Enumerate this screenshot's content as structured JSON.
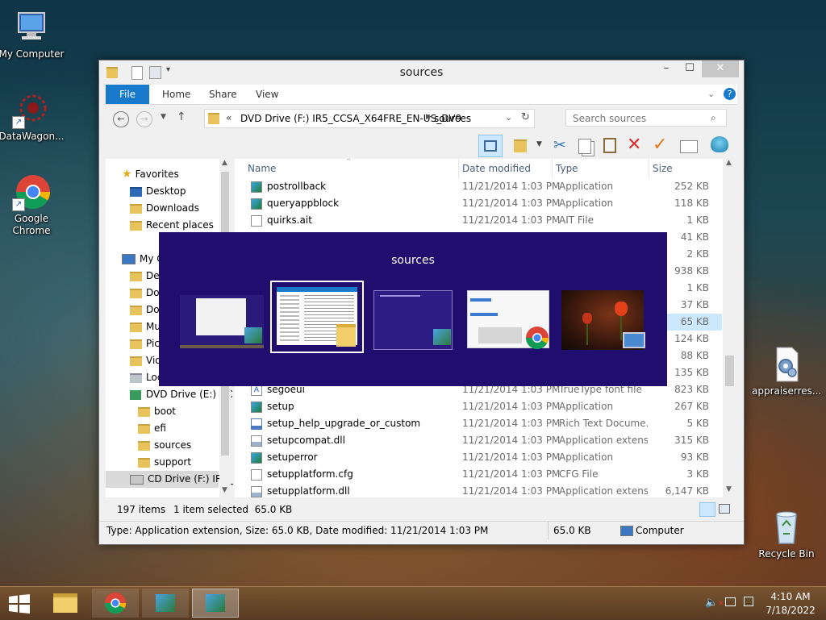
{
  "desktop": {
    "icons": [
      {
        "label": "My Computer",
        "icon": "computer-icon"
      },
      {
        "label": "DataWagon...",
        "icon": "datawagon-icon"
      },
      {
        "label": "Google Chrome",
        "icon": "chrome-icon"
      },
      {
        "label": "appraiserres...",
        "icon": "settings-file-icon"
      },
      {
        "label": "Recycle Bin",
        "icon": "recycle-bin-icon"
      }
    ]
  },
  "window": {
    "title": "sources",
    "ribbon_tabs": [
      "File",
      "Home",
      "Share",
      "View"
    ],
    "address": {
      "prefix": "«",
      "crumbs": [
        "DVD Drive (F:) IR5_CCSA_X64FRE_EN-US_DV9",
        "sources"
      ]
    },
    "search_placeholder": "Search sources",
    "nav": {
      "favorites_label": "Favorites",
      "favorites": [
        "Desktop",
        "Downloads",
        "Recent places"
      ],
      "computer_label": "My C",
      "computer_items": [
        "Des",
        "Do",
        "Do",
        "Mu",
        "Pic",
        "Vid",
        "Loc"
      ],
      "dvd_label": "DVD Drive (E:) CC",
      "dvd_children": [
        "boot",
        "efi",
        "sources",
        "support"
      ],
      "cd_label": "CD Drive (F:) IR5_"
    },
    "columns": {
      "name": "Name",
      "date": "Date modified",
      "type": "Type",
      "size": "Size"
    },
    "files": [
      {
        "name": "postrollback",
        "date": "11/21/2014 1:03 PM",
        "type": "Application",
        "size": "252 KB",
        "icon": "app"
      },
      {
        "name": "queryappblock",
        "date": "11/21/2014 1:03 PM",
        "type": "Application",
        "size": "118 KB",
        "icon": "app"
      },
      {
        "name": "quirks.ait",
        "date": "11/21/2014 1:03 PM",
        "type": "AIT File",
        "size": "1 KB",
        "icon": "file"
      },
      {
        "name": "",
        "date": "",
        "type": "",
        "size": "41 KB",
        "icon": ""
      },
      {
        "name": "",
        "date": "",
        "type": "",
        "size": "2 KB",
        "icon": ""
      },
      {
        "name": "",
        "date": "",
        "type": "",
        "size": "938 KB",
        "icon": ""
      },
      {
        "name": "",
        "date": "",
        "type": "",
        "size": "1 KB",
        "icon": ""
      },
      {
        "name": "",
        "date": "",
        "type": "",
        "size": "37 KB",
        "icon": ""
      },
      {
        "name": "",
        "date": "",
        "type": "",
        "size": "65 KB",
        "icon": "",
        "selected": true
      },
      {
        "name": "",
        "date": "",
        "type": "",
        "size": "124 KB",
        "icon": ""
      },
      {
        "name": "",
        "date": "",
        "type": "",
        "size": "88 KB",
        "icon": ""
      },
      {
        "name": "",
        "date": "",
        "type": "",
        "size": "135 KB",
        "icon": ""
      },
      {
        "name": "segoeui",
        "date": "11/21/2014 1:03 PM",
        "type": "TrueType font file",
        "size": "823 KB",
        "icon": "font"
      },
      {
        "name": "setup",
        "date": "11/21/2014 1:03 PM",
        "type": "Application",
        "size": "267 KB",
        "icon": "app"
      },
      {
        "name": "setup_help_upgrade_or_custom",
        "date": "11/21/2014 1:03 PM",
        "type": "Rich Text Docume...",
        "size": "5 KB",
        "icon": "rtf"
      },
      {
        "name": "setupcompat.dll",
        "date": "11/21/2014 1:03 PM",
        "type": "Application extens...",
        "size": "315 KB",
        "icon": "dll"
      },
      {
        "name": "setuperror",
        "date": "11/21/2014 1:03 PM",
        "type": "Application",
        "size": "93 KB",
        "icon": "app"
      },
      {
        "name": "setupplatform.cfg",
        "date": "11/21/2014 1:03 PM",
        "type": "CFG File",
        "size": "3 KB",
        "icon": "file"
      },
      {
        "name": "setupplatform.dll",
        "date": "11/21/2014 1:03 PM",
        "type": "Application extens...",
        "size": "6,147 KB",
        "icon": "dll"
      }
    ],
    "item_count": "197 items",
    "selected_info": "1 item selected  65.0 KB",
    "details_bar": {
      "text": "Type: Application extension, Size: 65.0 KB, Date modified: 11/21/2014 1:03 PM",
      "size": "65.0 KB",
      "location": "Computer"
    }
  },
  "alt_tab": {
    "title": "sources",
    "thumbnails": [
      "desktop-window",
      "sources-explorer",
      "setup-window",
      "chrome-window",
      "tulips-photo"
    ],
    "selected_index": 1
  },
  "taskbar": {
    "apps": [
      "file-explorer",
      "chrome",
      "setup",
      "setup-active"
    ],
    "time": "4:10 AM",
    "date": "7/18/2022"
  },
  "colors": {
    "accent": "#1979ca",
    "alt_tab_bg": "#1f0e6e",
    "selection": "#cce8ff"
  }
}
